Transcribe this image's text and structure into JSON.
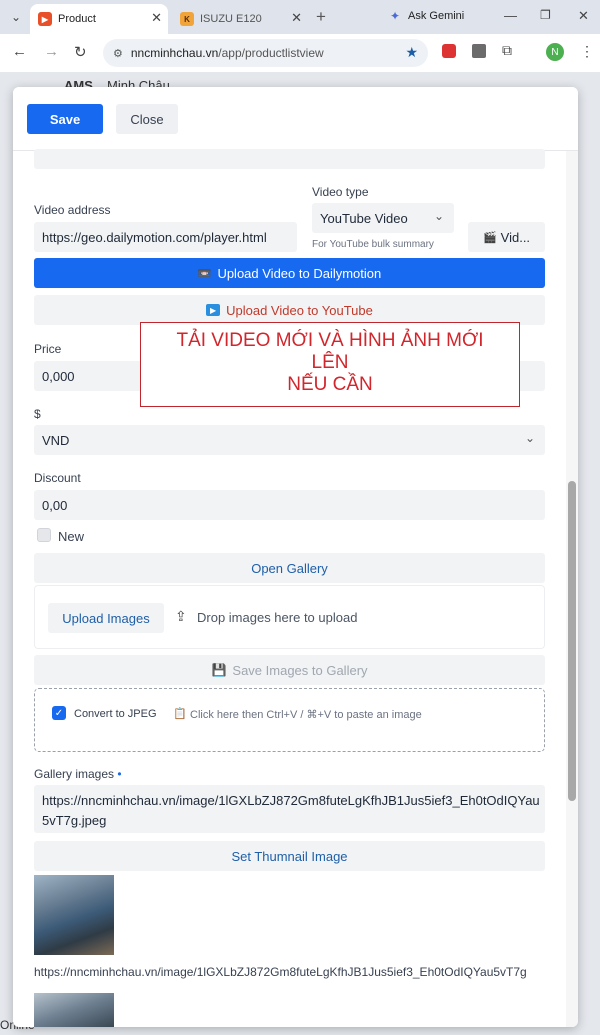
{
  "browser": {
    "tabs": [
      {
        "title": "Product",
        "active": true
      },
      {
        "title": "ISUZU E120",
        "active": false
      }
    ],
    "gemini_label": "Ask Gemini",
    "url_domain": "nncminhchau.vn",
    "url_path": "/app/productlistview",
    "profile_initial": "N"
  },
  "background": {
    "app_label": "AMS",
    "company": "Minh Châu",
    "status": "Online"
  },
  "modal": {
    "save_label": "Save",
    "close_label": "Close",
    "video_address_label": "Video address",
    "video_address_value": "https://geo.dailymotion.com/player.html",
    "video_type_label": "Video type",
    "video_type_value": "YouTube Video",
    "video_type_hint": "For YouTube bulk summary",
    "video_button_label": "Vid...",
    "upload_dailymotion_label": "Upload Video to Dailymotion",
    "upload_youtube_label": "Upload Video to YouTube",
    "price_label": "Price",
    "price_value": "0,000",
    "currency_label": "$",
    "currency_value": "VND",
    "discount_label": "Discount",
    "discount_value": "0,00",
    "new_label": "New",
    "open_gallery_label": "Open Gallery",
    "upload_images_label": "Upload Images",
    "drop_label": "Drop images here to upload",
    "save_images_label": "Save Images to Gallery",
    "convert_jpeg_label": "Convert to JPEG",
    "paste_hint": "Click here then Ctrl+V / ⌘+V to paste an image",
    "gallery_images_label": "Gallery images",
    "gallery_required_mark": "•",
    "gallery_url": "https://nncminhchau.vn/image/1lGXLbZJ872Gm8futeLgKfhJB1Jus5ief3_Eh0tOdIQYau5vT7g.jpeg",
    "set_thumbnail_label": "Set Thumnail Image",
    "image_caption": "https://nncminhchau.vn/image/1lGXLbZJ872Gm8futeLgKfhJB1Jus5ief3_Eh0tOdIQYau5vT7g"
  },
  "annotation": {
    "line1": "TẢI VIDEO MỚI VÀ HÌNH ẢNH MỚI",
    "line2": "LÊN",
    "line3": "NẾU CẦN"
  },
  "colors": {
    "primary": "#1769f0",
    "annotation_red": "#d1262c"
  }
}
